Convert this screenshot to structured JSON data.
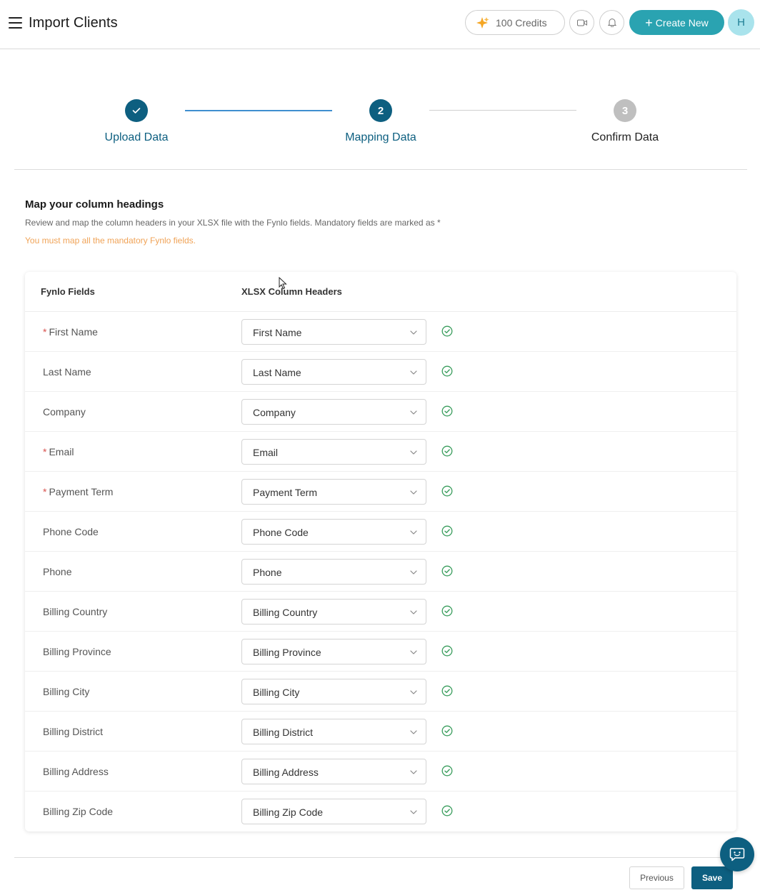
{
  "header": {
    "title": "Import Clients",
    "credits_label": "100 Credits",
    "create_label": "Create New",
    "avatar_initial": "H"
  },
  "stepper": {
    "steps": [
      {
        "label": "Upload Data",
        "number": "",
        "state": "done"
      },
      {
        "label": "Mapping Data",
        "number": "2",
        "state": "active"
      },
      {
        "label": "Confirm Data",
        "number": "3",
        "state": "pending"
      }
    ]
  },
  "intro": {
    "title": "Map your column headings",
    "description": "Review and map the column headers in your XLSX file with the Fynlo fields. Mandatory fields are marked as *",
    "warning": "You must map all the mandatory Fynlo fields."
  },
  "table": {
    "col_fields": "Fynlo Fields",
    "col_headers": "XLSX Column Headers",
    "required_mark": "*",
    "rows": [
      {
        "field": "First Name",
        "required": true,
        "mapped": "First Name"
      },
      {
        "field": "Last  Name",
        "required": false,
        "mapped": "Last  Name"
      },
      {
        "field": "Company",
        "required": false,
        "mapped": "Company"
      },
      {
        "field": "Email",
        "required": true,
        "mapped": "Email"
      },
      {
        "field": "Payment Term",
        "required": true,
        "mapped": "Payment Term"
      },
      {
        "field": "Phone Code",
        "required": false,
        "mapped": "Phone Code"
      },
      {
        "field": "Phone",
        "required": false,
        "mapped": "Phone"
      },
      {
        "field": "Billing Country",
        "required": false,
        "mapped": "Billing Country"
      },
      {
        "field": "Billing Province",
        "required": false,
        "mapped": "Billing Province"
      },
      {
        "field": "Billing City",
        "required": false,
        "mapped": "Billing City"
      },
      {
        "field": "Billing District",
        "required": false,
        "mapped": "Billing District"
      },
      {
        "field": "Billing Address",
        "required": false,
        "mapped": "Billing Address"
      },
      {
        "field": "Billing Zip Code",
        "required": false,
        "mapped": "Billing Zip Code"
      }
    ]
  },
  "footer": {
    "previous_label": "Previous",
    "save_label": "Save"
  },
  "colors": {
    "primary": "#0d5f80",
    "accent": "#2aa3b1",
    "warning": "#f0a357",
    "success": "#3a9d5d",
    "required": "#d9534f"
  }
}
